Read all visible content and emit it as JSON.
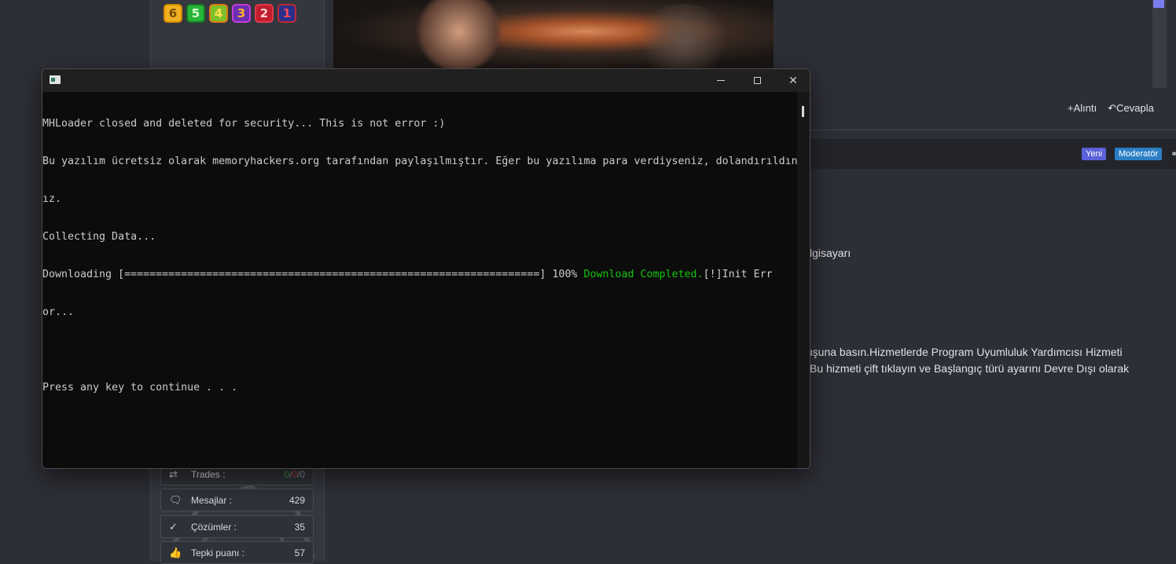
{
  "forum": {
    "badges": [
      {
        "label": "6",
        "name": "rank-6-badge-icon"
      },
      {
        "label": "5",
        "name": "rank-5-badge-icon"
      },
      {
        "label": "4",
        "name": "rank-4-badge-icon"
      },
      {
        "label": "3",
        "name": "rank-3-badge-icon"
      },
      {
        "label": "2",
        "name": "rank-2-badge-icon"
      },
      {
        "label": "1",
        "name": "rank-1-badge-icon"
      }
    ],
    "quote_label": "Alıntı",
    "reply_label": "Cevapla",
    "tags": {
      "new": "Yeni",
      "moderator": "Moderatör"
    },
    "body_lines": [
      "lgisayarı",
      "tuşuna basın.Hizmetlerde Program Uyumluluk Yardımcısı Hizmeti",
      "Bu hizmeti çift tıklayın ve Başlangıç türü ayarını Devre Dışı olarak"
    ],
    "stats": [
      {
        "label": "Trades :",
        "icon": "swap-arrows-icon"
      },
      {
        "label": "Mesajlar :",
        "value": "429",
        "icon": "chat-bubbles-icon"
      },
      {
        "label": "Çözümler :",
        "value": "35",
        "icon": "checkmark-icon"
      },
      {
        "label": "Tepki puanı :",
        "value": "57",
        "icon": "thumbs-up-icon"
      }
    ],
    "trades_parts": [
      "0",
      "/",
      "0",
      "/",
      "0"
    ],
    "colors": {
      "trade_pos": "#3c8a3a",
      "trade_neg": "#b0402a",
      "trade_neu": "#8c8f96"
    }
  },
  "console": {
    "lines": [
      "MHLoader closed and deleted for security... This is not error :)",
      "Bu yazılım ücretsiz olarak memoryhackers.org tarafından paylaşılmıştır. Eğer bu yazılıma para verdiyseniz, dolandırıldın",
      "ız.",
      "Collecting Data..."
    ],
    "download_prefix": "Downloading [==================================================================] 100% ",
    "download_completed": "Download Completed.",
    "download_suffix": "[!]Init Err",
    "wrap_line": "or...",
    "prompt": "Press any key to continue . . .",
    "colors": {
      "background": "#0c0c0c",
      "text": "#cccccc",
      "success": "#16c60c"
    }
  }
}
